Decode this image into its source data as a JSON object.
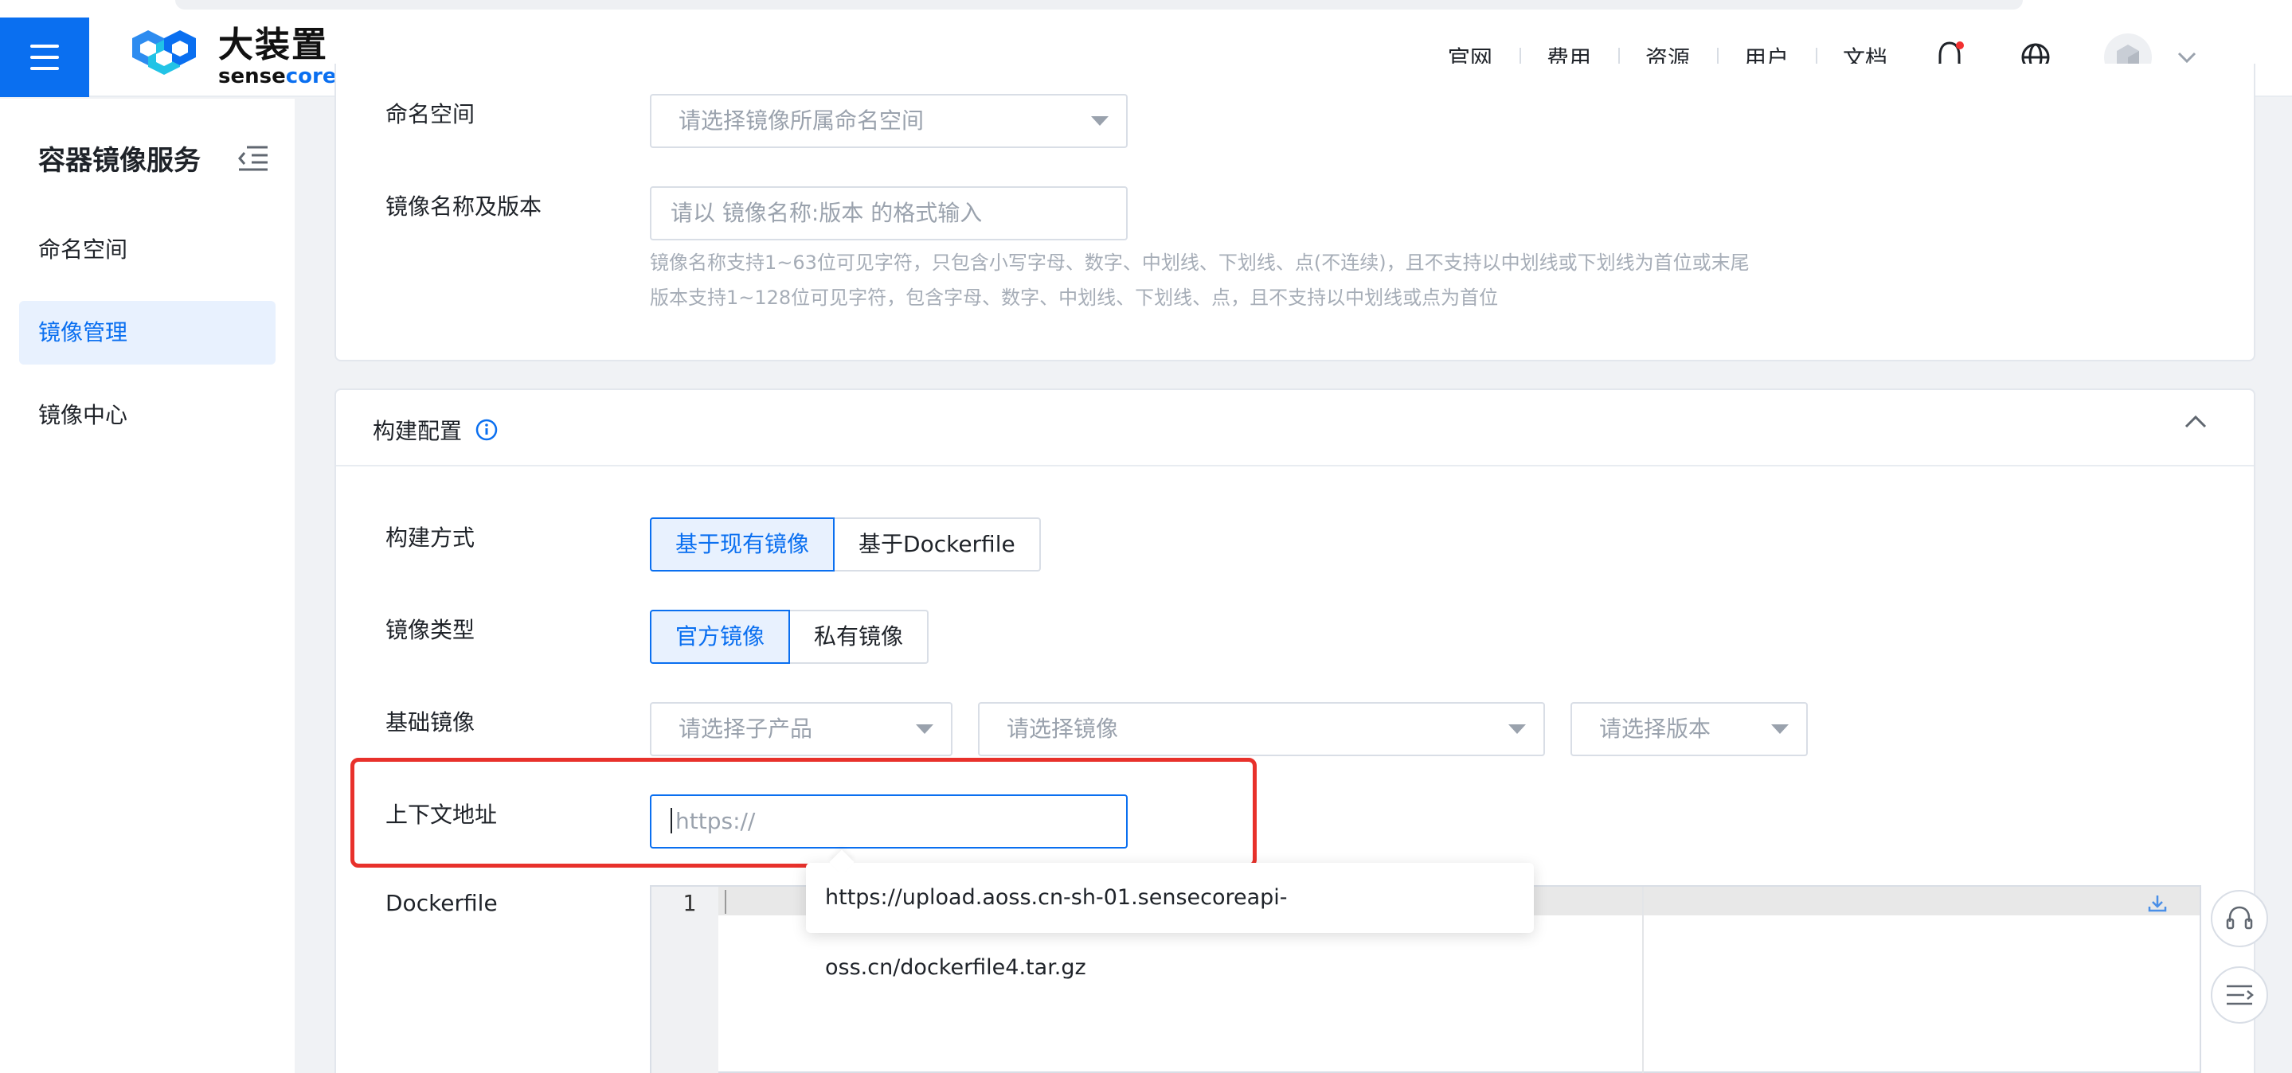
{
  "header": {
    "logo_cn": "大装置",
    "logo_en_sense": "sense",
    "logo_en_core": "core",
    "nav": [
      "官网",
      "费用",
      "资源",
      "用户",
      "文档"
    ],
    "accent_color": "#0a6ff0"
  },
  "sidebar": {
    "title": "容器镜像服务",
    "items": [
      {
        "label": "命名空间",
        "active": false
      },
      {
        "label": "镜像管理",
        "active": true
      },
      {
        "label": "镜像中心",
        "active": false
      }
    ]
  },
  "basic": {
    "namespace_label": "命名空间",
    "namespace_placeholder": "请选择镜像所属命名空间",
    "name_label": "镜像名称及版本",
    "name_placeholder": "请以 镜像名称:版本 的格式输入",
    "hint1": "镜像名称支持1~63位可见字符，只包含小写字母、数字、中划线、下划线、点(不连续)，且不支持以中划线或下划线为首位或末尾",
    "hint2": "版本支持1~128位可见字符，包含字母、数字、中划线、下划线、点，且不支持以中划线或点为首位"
  },
  "build": {
    "section_title": "构建配置",
    "method_label": "构建方式",
    "method_options": [
      "基于现有镜像",
      "基于Dockerfile"
    ],
    "method_selected": "基于现有镜像",
    "type_label": "镜像类型",
    "type_options": [
      "官方镜像",
      "私有镜像"
    ],
    "type_selected": "官方镜像",
    "base_label": "基础镜像",
    "base_product_placeholder": "请选择子产品",
    "base_image_placeholder": "请选择镜像",
    "base_version_placeholder": "请选择版本",
    "context_label": "上下文地址",
    "context_placeholder": "https://",
    "dockerfile_label": "Dockerfile",
    "editor_line": "1",
    "tooltip_text": "https://upload.aoss.cn-sh-01.sensecoreapi-oss.cn/dockerfile4.tar.gz"
  }
}
